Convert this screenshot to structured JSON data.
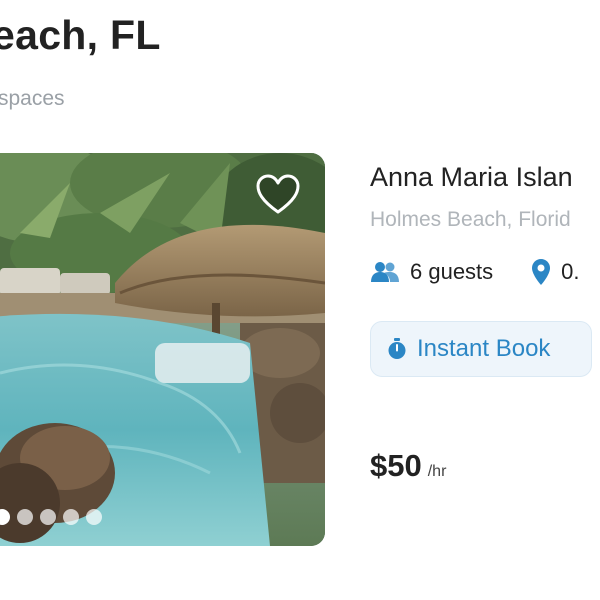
{
  "header": {
    "title": "each, FL",
    "subtitle": "spaces"
  },
  "listing": {
    "name": "Anna Maria Islan",
    "location": "Holmes Beach, Florid",
    "guests": "6 guests",
    "distance": "0.",
    "instant_book_label": "Instant Book",
    "price": "$50",
    "price_unit": "/hr",
    "photo_count": 5,
    "active_photo_index": 0
  },
  "icons": {
    "favorite": "heart-icon",
    "guests": "people-icon",
    "distance": "location-pin-icon",
    "instant_book": "stopwatch-icon"
  },
  "colors": {
    "accent": "#2b86c5",
    "accent_bg": "#eef5fb",
    "text": "#222222",
    "muted": "#9aa0a6"
  }
}
